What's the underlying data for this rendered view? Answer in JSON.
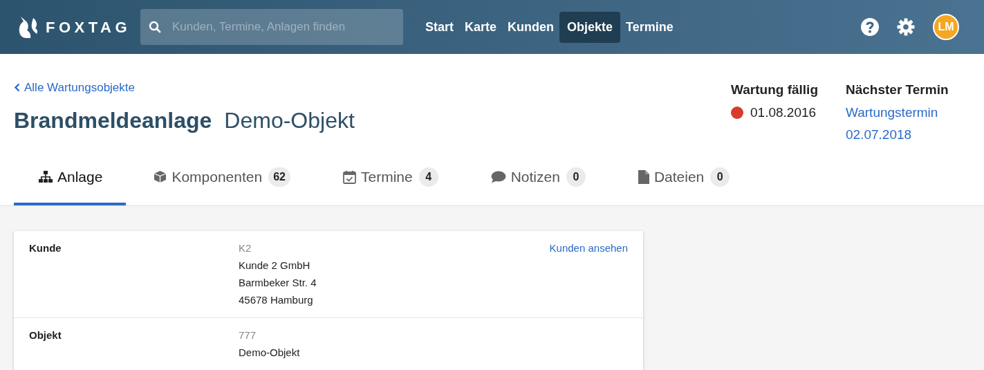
{
  "header": {
    "logo": "FOXTAG",
    "search": {
      "placeholder": "Kunden, Termine, Anlagen finden"
    },
    "nav": [
      {
        "label": "Start",
        "selected": false
      },
      {
        "label": "Karte",
        "selected": false
      },
      {
        "label": "Kunden",
        "selected": false
      },
      {
        "label": "Objekte",
        "selected": true
      },
      {
        "label": "Termine",
        "selected": false
      }
    ],
    "avatar": "LM"
  },
  "back_link": "Alle Wartungsobjekte",
  "title": "Brandmeldeanlage",
  "subtitle": "Demo-Objekt",
  "maintenance": {
    "label": "Wartung fällig",
    "date": "01.08.2016",
    "color": "#d63c2c"
  },
  "next_appointment": {
    "label": "Nächster Termin",
    "link": "Wartungstermin",
    "date": "02.07.2018"
  },
  "tabs": [
    {
      "label": "Anlage",
      "selected": true
    },
    {
      "label": "Komponenten",
      "count": "62",
      "selected": false
    },
    {
      "label": "Termine",
      "count": "4",
      "selected": false
    },
    {
      "label": "Notizen",
      "count": "0",
      "selected": false
    },
    {
      "label": "Dateien",
      "count": "0",
      "selected": false
    }
  ],
  "details": [
    {
      "label": "Kunde",
      "code": "K2",
      "lines": [
        "Kunde 2 GmbH",
        "Barmbeker Str. 4",
        "45678 Hamburg"
      ],
      "link": "Kunden ansehen"
    },
    {
      "label": "Objekt",
      "code": "777",
      "lines": [
        "Demo-Objekt"
      ]
    }
  ]
}
